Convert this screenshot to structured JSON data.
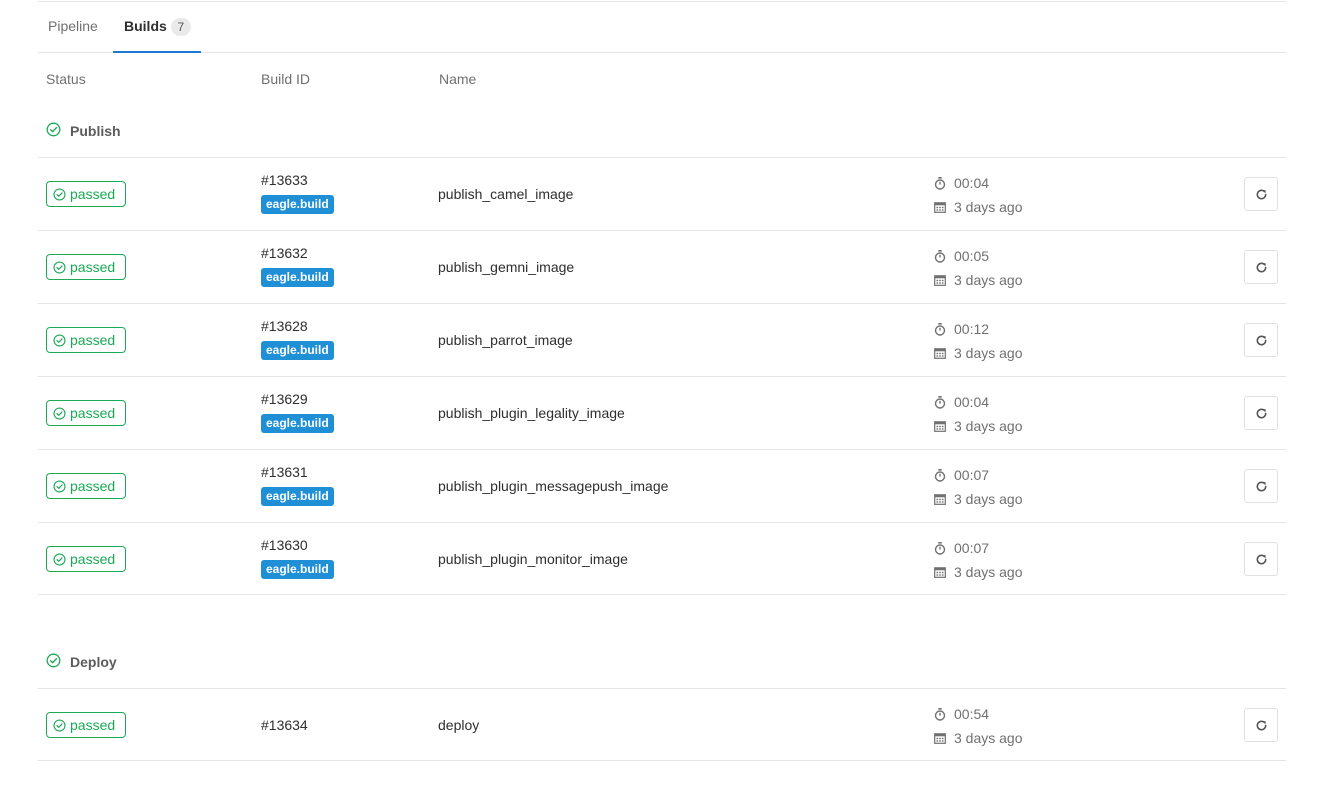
{
  "tabs": {
    "pipeline": "Pipeline",
    "builds": "Builds",
    "builds_count": "7"
  },
  "columns": {
    "status": "Status",
    "build_id": "Build ID",
    "name": "Name"
  },
  "colors": {
    "success": "#1aaa55",
    "tag": "#1f8fd6",
    "active_tab": "#1f78d1"
  },
  "stages": [
    {
      "name": "Publish",
      "jobs": [
        {
          "status": "passed",
          "id": "#13633",
          "tag": "eagle.build",
          "name": "publish_camel_image",
          "duration": "00:04",
          "finished": "3 days ago"
        },
        {
          "status": "passed",
          "id": "#13632",
          "tag": "eagle.build",
          "name": "publish_gemni_image",
          "duration": "00:05",
          "finished": "3 days ago"
        },
        {
          "status": "passed",
          "id": "#13628",
          "tag": "eagle.build",
          "name": "publish_parrot_image",
          "duration": "00:12",
          "finished": "3 days ago"
        },
        {
          "status": "passed",
          "id": "#13629",
          "tag": "eagle.build",
          "name": "publish_plugin_legality_image",
          "duration": "00:04",
          "finished": "3 days ago"
        },
        {
          "status": "passed",
          "id": "#13631",
          "tag": "eagle.build",
          "name": "publish_plugin_messagepush_image",
          "duration": "00:07",
          "finished": "3 days ago"
        },
        {
          "status": "passed",
          "id": "#13630",
          "tag": "eagle.build",
          "name": "publish_plugin_monitor_image",
          "duration": "00:07",
          "finished": "3 days ago"
        }
      ]
    },
    {
      "name": "Deploy",
      "jobs": [
        {
          "status": "passed",
          "id": "#13634",
          "name": "deploy",
          "duration": "00:54",
          "finished": "3 days ago"
        }
      ]
    }
  ]
}
